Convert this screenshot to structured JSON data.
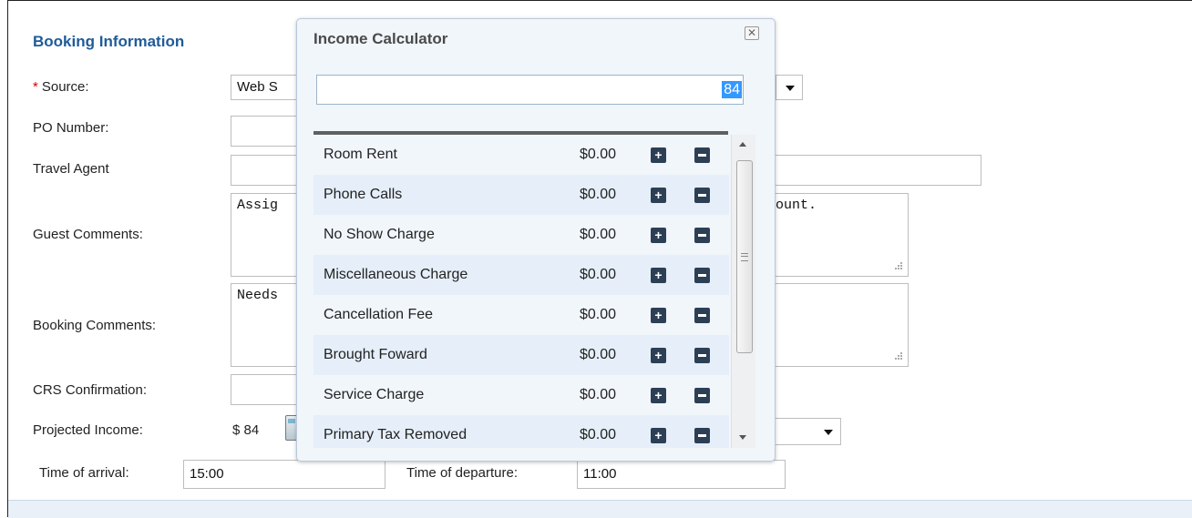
{
  "booking": {
    "section_title": "Booking Information",
    "required_marker": "*",
    "source_label": "Source:",
    "source_value": "Web S",
    "po_label": "PO Number:",
    "po_value": "",
    "travel_agent_label": "Travel Agent",
    "travel_agent_value": "",
    "guest_comments_label": "Guest Comments:",
    "guest_comments_visible_start": "Assig",
    "guest_comments_visible_end": "ount.",
    "booking_comments_label": "Booking Comments:",
    "booking_comments_visible_start": "Needs",
    "crs_label": "CRS Confirmation:",
    "crs_value": "",
    "projected_income_label": "Projected Income:",
    "projected_income_value": "$ 84",
    "arrival_label": "Time of arrival:",
    "arrival_value": "15:00",
    "departure_label": "Time of departure:",
    "departure_value": "11:00"
  },
  "calculator": {
    "title": "Income Calculator",
    "close_icon": "close-icon",
    "input_value": "84",
    "items": [
      {
        "label": "Room Rent",
        "amount": "$0.00"
      },
      {
        "label": "Phone Calls",
        "amount": "$0.00"
      },
      {
        "label": "No Show Charge",
        "amount": "$0.00"
      },
      {
        "label": "Miscellaneous Charge",
        "amount": "$0.00"
      },
      {
        "label": "Cancellation Fee",
        "amount": "$0.00"
      },
      {
        "label": "Brought Foward",
        "amount": "$0.00"
      },
      {
        "label": "Service Charge",
        "amount": "$0.00"
      },
      {
        "label": "Primary Tax Removed",
        "amount": "$0.00"
      }
    ],
    "plus_glyph": "+"
  },
  "colors": {
    "section_title": "#1f5b98",
    "required": "#d60000",
    "popup_bg": "#f1f6fb",
    "row_alt": "#e6eff9",
    "button": "#2c3f55",
    "selection": "#3399ff"
  }
}
